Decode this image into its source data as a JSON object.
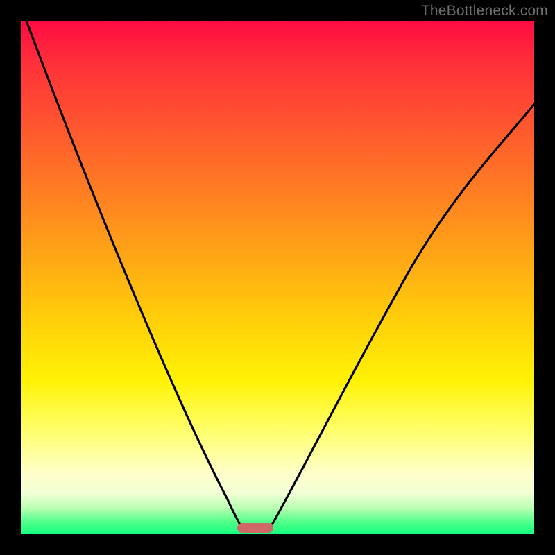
{
  "watermark": "TheBottleneck.com",
  "chart_data": {
    "type": "line",
    "title": "",
    "xlabel": "",
    "ylabel": "",
    "xlim": [
      0,
      100
    ],
    "ylim": [
      0,
      100
    ],
    "grid": false,
    "legend": false,
    "background_gradient": {
      "direction": "vertical",
      "stops": [
        {
          "pos": 0.0,
          "color": "#ff0b42"
        },
        {
          "pos": 0.08,
          "color": "#ff2f3a"
        },
        {
          "pos": 0.2,
          "color": "#ff5530"
        },
        {
          "pos": 0.33,
          "color": "#ff7d23"
        },
        {
          "pos": 0.46,
          "color": "#ffa716"
        },
        {
          "pos": 0.58,
          "color": "#ffce0a"
        },
        {
          "pos": 0.7,
          "color": "#fff205"
        },
        {
          "pos": 0.8,
          "color": "#ffff6f"
        },
        {
          "pos": 0.88,
          "color": "#ffffc9"
        },
        {
          "pos": 0.92,
          "color": "#f3ffd6"
        },
        {
          "pos": 0.95,
          "color": "#b6ffb0"
        },
        {
          "pos": 0.975,
          "color": "#55ff8c"
        },
        {
          "pos": 1.0,
          "color": "#12ff7e"
        }
      ]
    },
    "series": [
      {
        "name": "left-curve",
        "stroke": "#000000",
        "x": [
          0,
          2,
          4,
          6,
          8,
          10,
          12,
          14,
          16,
          18,
          20,
          22,
          24,
          26,
          28,
          30,
          32,
          34,
          36,
          38,
          40,
          41,
          42,
          43
        ],
        "y": [
          100,
          92,
          85,
          78,
          72,
          66,
          60,
          54,
          49,
          44,
          39,
          35,
          31,
          27,
          23,
          20,
          16,
          13,
          10,
          7,
          4,
          2,
          1,
          0
        ]
      },
      {
        "name": "right-curve",
        "stroke": "#000000",
        "x": [
          48,
          50,
          52,
          55,
          58,
          61,
          64,
          68,
          72,
          76,
          80,
          84,
          88,
          92,
          96,
          100
        ],
        "y": [
          0,
          2,
          5,
          9,
          14,
          19,
          24,
          30,
          37,
          44,
          51,
          58,
          65,
          72,
          78,
          84
        ]
      }
    ],
    "marker": {
      "name": "min-band",
      "shape": "rounded-rect",
      "fill": "#d16868",
      "x_range": [
        42,
        49
      ],
      "y": 0,
      "height_frac": 0.018
    }
  }
}
